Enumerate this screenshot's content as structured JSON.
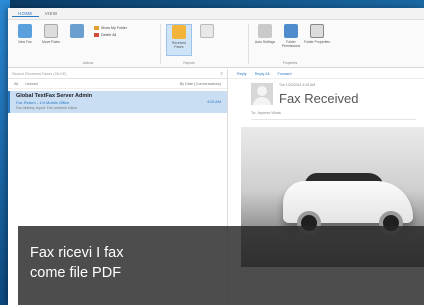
{
  "ribbon": {
    "tabs": [
      "HOME",
      "VIEW"
    ],
    "buttons": {
      "new_fax": "New Fax",
      "move_rules": "Move Rules",
      "show_folder": "Show My Folder",
      "delete": "Delete All",
      "received_faxes": "Received Faxes",
      "auto_settings": "Auto Settings",
      "folder_permissions": "Folder Permissions",
      "folder_properties": "Folder Properties"
    },
    "groups": [
      "Actions",
      "Reports",
      "Properties"
    ]
  },
  "mail_list": {
    "search_placeholder": "Search Received Faxes (Ctrl+E)",
    "filter_tabs": [
      "All",
      "Unread"
    ],
    "sort_label": "By Date (Conversations)",
    "items": [
      {
        "from": "Global TextFax Server Admin",
        "subject": "Fax Return - 1/4 Mobile Office",
        "preview": "Fax delivery report. Fax contents follow.",
        "time": "4:03 AM"
      }
    ]
  },
  "reading_pane": {
    "actions": [
      "Reply",
      "Reply All",
      "Forward"
    ],
    "meta": "Tue 1/02/2024 4:03 AM",
    "title": "Fax Received",
    "to": "To: Jaymes Wirds"
  },
  "caption": {
    "line1": "Fax ricevi I fax",
    "line2": "come file PDF"
  }
}
